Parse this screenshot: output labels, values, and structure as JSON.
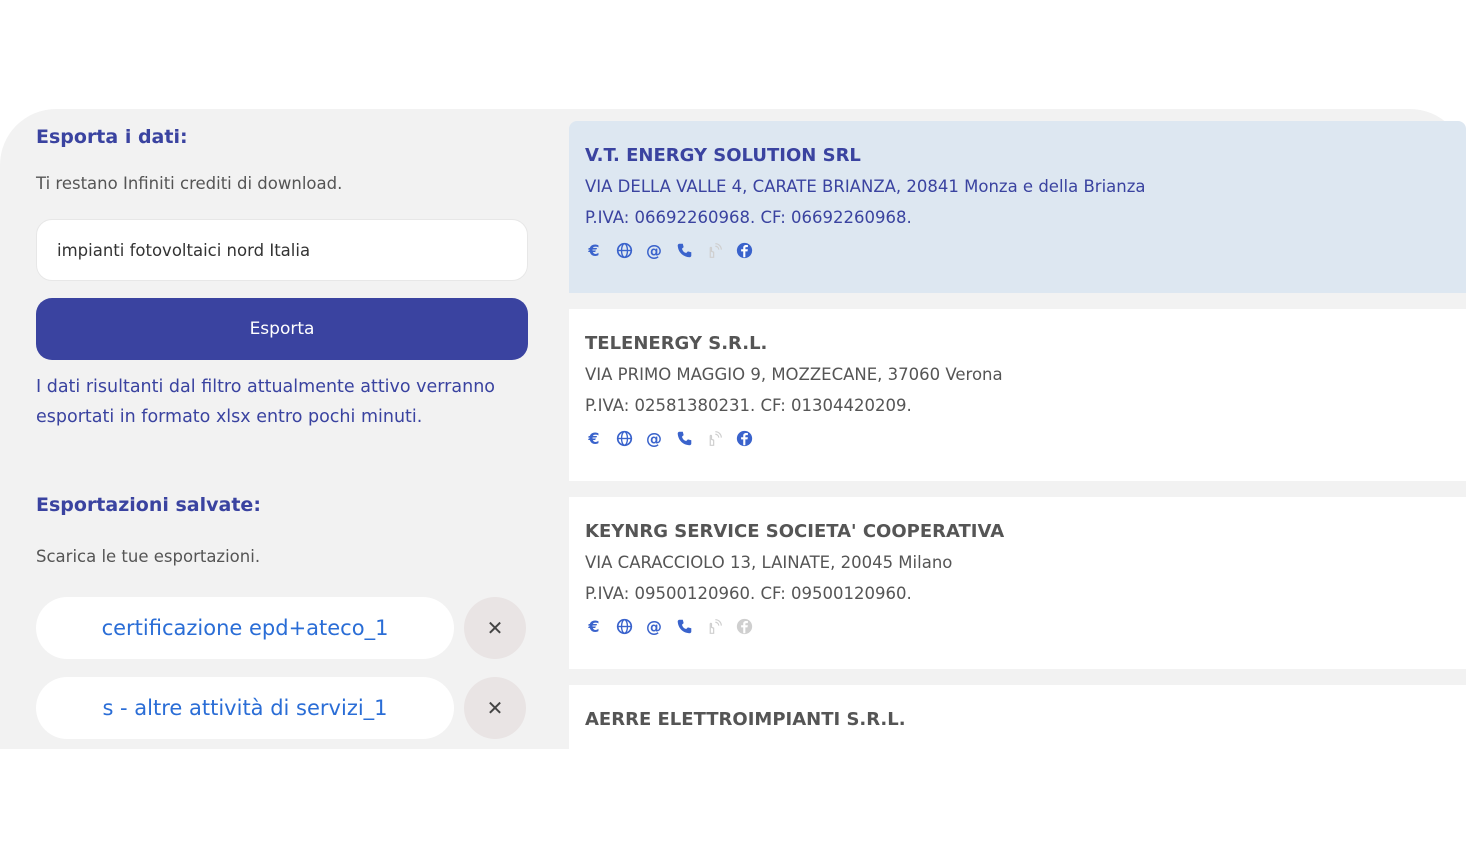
{
  "export": {
    "title": "Esporta i dati:",
    "credits_text": "Ti restano Infiniti crediti di download.",
    "search_value": "impianti fotovoltaici nord Italia",
    "export_button": "Esporta",
    "info_text": "I dati risultanti dal filtro attualmente attivo verranno esportati in formato xlsx entro pochi minuti."
  },
  "saved": {
    "title": "Esportazioni salvate:",
    "subtitle": "Scarica le tue esportazioni.",
    "remove_glyph": "✕",
    "items": [
      {
        "label": "certificazione epd+ateco_1"
      },
      {
        "label": "s - altre attività di servizi_1"
      }
    ]
  },
  "results": [
    {
      "name": "V.T. ENERGY SOLUTION SRL",
      "address": "VIA DELLA VALLE 4, CARATE BRIANZA, 20841 Monza e della Brianza",
      "tax": "P.IVA: 06692260968. CF: 06692260968.",
      "selected": true,
      "icons": [
        "euro-icon",
        "globe-icon",
        "at-icon",
        "phone-icon",
        "pec-icon",
        "facebook-icon"
      ],
      "icons_on": [
        true,
        true,
        true,
        true,
        false,
        true
      ]
    },
    {
      "name": "TELENERGY S.R.L.",
      "address": "VIA PRIMO MAGGIO 9, MOZZECANE, 37060 Verona",
      "tax": "P.IVA: 02581380231. CF: 01304420209.",
      "selected": false,
      "icons": [
        "euro-icon",
        "globe-icon",
        "at-icon",
        "phone-icon",
        "pec-icon",
        "facebook-icon"
      ],
      "icons_on": [
        true,
        true,
        true,
        true,
        false,
        true
      ]
    },
    {
      "name": "KEYNRG SERVICE SOCIETA' COOPERATIVA",
      "address": "VIA CARACCIOLO 13, LAINATE, 20045 Milano",
      "tax": "P.IVA: 09500120960. CF: 09500120960.",
      "selected": false,
      "icons": [
        "euro-icon",
        "globe-icon",
        "at-icon",
        "phone-icon",
        "pec-icon",
        "facebook-icon"
      ],
      "icons_on": [
        true,
        true,
        true,
        true,
        false,
        false
      ]
    },
    {
      "name": "AERRE ELETTROIMPIANTI S.R.L.",
      "address": "",
      "tax": "",
      "selected": false,
      "icons": [],
      "icons_on": []
    }
  ],
  "colors": {
    "accent": "#3a43a0",
    "link_blue": "#2a6dd6",
    "icon_blue": "#3a63cc",
    "icon_off": "#cfcfcf",
    "selected_bg": "#dde7f1"
  }
}
